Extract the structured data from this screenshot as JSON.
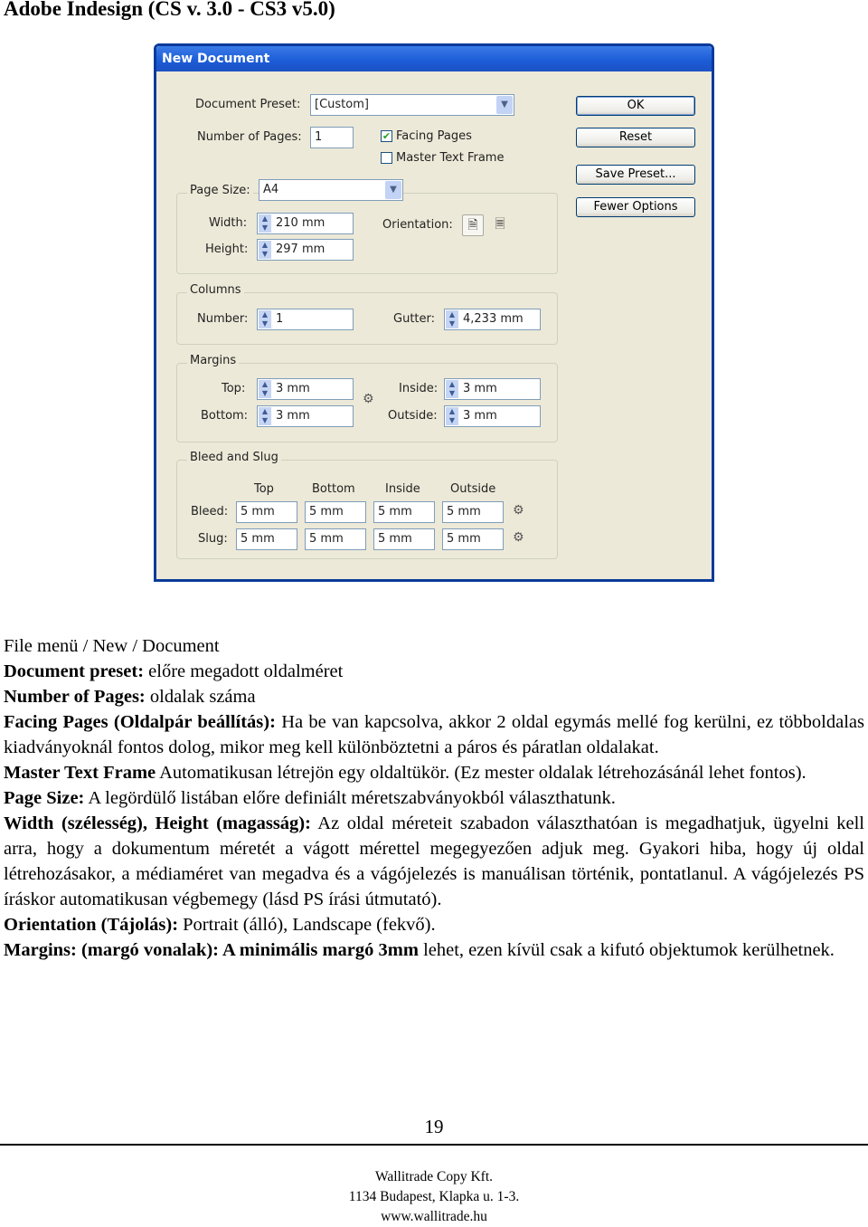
{
  "document": {
    "title": "Adobe Indesign (CS v. 3.0 - CS3 v5.0)"
  },
  "dialog": {
    "title": "New Document",
    "document_preset": {
      "label": "Document Preset:",
      "value": "[Custom]"
    },
    "number_of_pages": {
      "label": "Number of Pages:",
      "value": "1"
    },
    "facing_pages": {
      "label": "Facing Pages",
      "checked": true
    },
    "master_text_frame": {
      "label": "Master Text Frame",
      "checked": false
    },
    "buttons": {
      "ok": "OK",
      "reset": "Reset",
      "save_preset": "Save Preset...",
      "fewer_options": "Fewer Options"
    },
    "page_size": {
      "label": "Page Size:",
      "value": "A4"
    },
    "width": {
      "label": "Width:",
      "value": "210 mm"
    },
    "height": {
      "label": "Height:",
      "value": "297 mm"
    },
    "orientation": {
      "label": "Orientation:",
      "selected": "portrait"
    },
    "columns": {
      "group_label": "Columns",
      "number": {
        "label": "Number:",
        "value": "1"
      },
      "gutter": {
        "label": "Gutter:",
        "value": "4,233 mm"
      }
    },
    "margins": {
      "group_label": "Margins",
      "top": {
        "label": "Top:",
        "value": "3 mm"
      },
      "bottom": {
        "label": "Bottom:",
        "value": "3 mm"
      },
      "inside": {
        "label": "Inside:",
        "value": "3 mm"
      },
      "outside": {
        "label": "Outside:",
        "value": "3 mm"
      }
    },
    "bleed_slug": {
      "group_label": "Bleed and Slug",
      "columns": [
        "Top",
        "Bottom",
        "Inside",
        "Outside"
      ],
      "bleed": {
        "label": "Bleed:",
        "values": [
          "5 mm",
          "5 mm",
          "5 mm",
          "5 mm"
        ]
      },
      "slug": {
        "label": "Slug:",
        "values": [
          "5 mm",
          "5 mm",
          "5 mm",
          "5 mm"
        ]
      }
    }
  },
  "body": {
    "p1": "File menü / New / Document",
    "p2_bold": "Document preset:",
    "p2_text": " előre megadott oldalméret",
    "p3_bold": "Number of Pages:",
    "p3_text": " oldalak száma",
    "p4_bold": "Facing Pages (Oldalpár beállítás):",
    "p4_text": " Ha be van kapcsolva, akkor 2 oldal egymás mellé fog kerülni, ez többoldalas kiadványoknál fontos dolog, mikor meg kell különböztetni a páros és páratlan oldalakat.",
    "p5_bold": "Master Text Frame",
    "p5_text": " Automatikusan létrejön egy oldaltükör. (Ez mester oldalak létrehozásánál lehet fontos).",
    "p6_bold": "Page Size:",
    "p6_text": " A legördülő listában előre definiált méretszabványokból választhatunk.",
    "p7_bold": "Width (szélesség), Height (magasság):",
    "p7_text": " Az oldal méreteit szabadon választhatóan is megadhatjuk, ügyelni kell arra, hogy a dokumentum méretét a vágott mérettel megegyezően adjuk meg. Gyakori hiba, hogy új oldal létrehozásakor, a médiaméret van megadva és a vágójelezés is manuálisan történik, pontatlanul. A vágójelezés PS íráskor automatikusan végbemegy (lásd PS írási útmutató).",
    "p8_bold": "Orientation (Tájolás):",
    "p8_text": " Portrait (álló), Landscape (fekvő).",
    "p9_bold": "Margins: (margó vonalak): A minimális margó 3mm",
    "p9_text": " lehet, ezen kívül csak a kifutó objektumok kerülhetnek."
  },
  "footer": {
    "page_number": "19",
    "company": "Wallitrade Copy Kft.",
    "address": "1134 Budapest, Klapka u. 1-3.",
    "website": "www.wallitrade.hu"
  }
}
